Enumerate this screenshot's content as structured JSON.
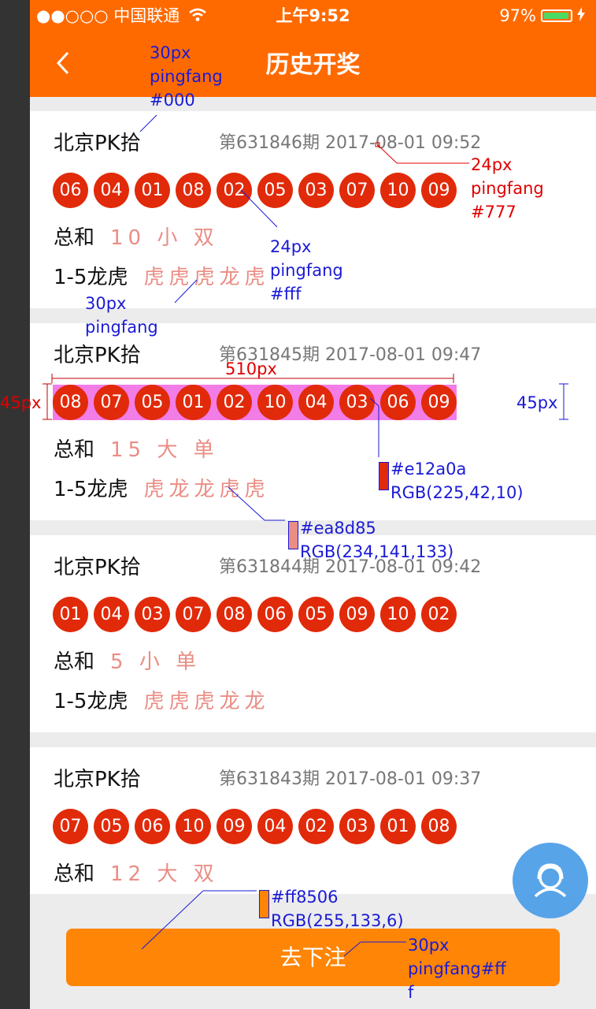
{
  "status_bar": {
    "carrier": "●●○○○ 中国联通",
    "time": "上午9:52",
    "battery": "97%",
    "battery_level": 0.97
  },
  "nav": {
    "title": "历史开奖",
    "back_icon": "chevron-left-icon"
  },
  "records": [
    {
      "name": "北京PK拾",
      "issue": "第631846期 2017-08-01 09:52",
      "balls": [
        "06",
        "04",
        "01",
        "08",
        "02",
        "05",
        "03",
        "07",
        "10",
        "09"
      ],
      "sum_label": "总和",
      "sum_value": "10 小 双",
      "dt_label": "1-5龙虎",
      "dt_value": "虎虎虎龙虎"
    },
    {
      "name": "北京PK拾",
      "issue": "第631845期 2017-08-01 09:47",
      "balls": [
        "08",
        "07",
        "05",
        "01",
        "02",
        "10",
        "04",
        "03",
        "06",
        "09"
      ],
      "sum_label": "总和",
      "sum_value": "15 大 单",
      "dt_label": "1-5龙虎",
      "dt_value": "虎龙龙虎虎"
    },
    {
      "name": "北京PK拾",
      "issue": "第631844期 2017-08-01 09:42",
      "balls": [
        "01",
        "04",
        "03",
        "07",
        "08",
        "06",
        "05",
        "09",
        "10",
        "02"
      ],
      "sum_label": "总和",
      "sum_value": "5 小 单",
      "dt_label": "1-5龙虎",
      "dt_value": "虎虎虎龙龙"
    },
    {
      "name": "北京PK拾",
      "issue": "第631843期 2017-08-01 09:37",
      "balls": [
        "07",
        "05",
        "06",
        "10",
        "09",
        "04",
        "02",
        "03",
        "01",
        "08"
      ],
      "sum_label": "总和",
      "sum_value": "12 大 双"
    }
  ],
  "bottom_button": {
    "label": "去下注"
  },
  "support_icon": "customer-service-icon",
  "annotations": {
    "a1": "30px\npingfang\n#000",
    "a2": "24px\npingfang\n#777",
    "a3": "24px\npingfang\n#fff",
    "a4": "30px\npingfang",
    "a5": "510px",
    "a6": "45px",
    "a7": "45px",
    "a8": "#e12a0a\nRGB(225,42,10)",
    "a9": "#ea8d85\nRGB(234,141,133)",
    "a10": "#ff8506\nRGB(255,133,6)",
    "a11": "30px\npingfang#ff\nf"
  },
  "colors": {
    "nav_bg": "#ff6a00",
    "ball": "#e12a0a",
    "highlight_value": "#ea8d85",
    "button": "#ff8506",
    "meta_text": "#777"
  }
}
